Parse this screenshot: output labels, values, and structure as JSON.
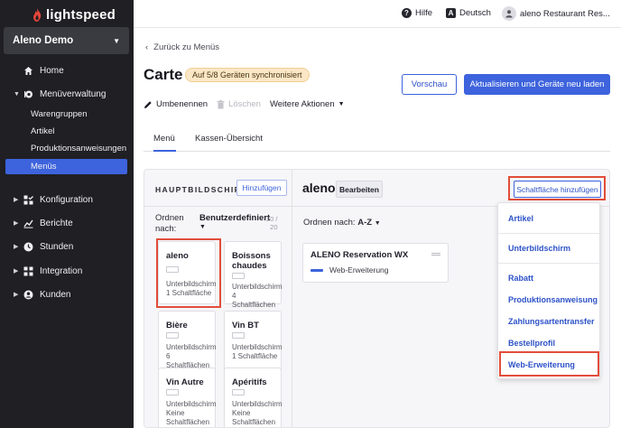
{
  "sidebar": {
    "logo_text": "lightspeed",
    "store_name": "Aleno Demo",
    "nav": [
      {
        "label": "Home",
        "icon": "home-icon"
      },
      {
        "label": "Menüverwaltung",
        "icon": "menu-management-icon"
      },
      {
        "label": "Konfiguration",
        "icon": "configuration-icon"
      },
      {
        "label": "Berichte",
        "icon": "reports-icon"
      },
      {
        "label": "Stunden",
        "icon": "clock-icon"
      },
      {
        "label": "Integration",
        "icon": "integration-icon"
      },
      {
        "label": "Kunden",
        "icon": "customers-icon"
      }
    ],
    "sub": [
      "Warengruppen",
      "Artikel",
      "Produktionsanweisungen",
      "Menüs"
    ]
  },
  "topbar": {
    "help": "Hilfe",
    "language": "Deutsch",
    "account": "aleno Restaurant Res..."
  },
  "page": {
    "back_link": "Zurück zu Menüs",
    "title": "Carte",
    "sync_badge": "Auf 5/8 Geräten synchronisiert",
    "preview_button": "Vorschau",
    "update_button": "Aktualisieren und Geräte neu laden",
    "actions": {
      "rename": "Umbenennen",
      "delete": "Löschen",
      "more": "Weitere Aktionen"
    },
    "tabs": [
      "Menü",
      "Kassen-Übersicht"
    ]
  },
  "left_panel": {
    "title": "HAUPTBILDSCHIRME",
    "add_button": "Hinzufügen",
    "sort_label_1": "Ordnen",
    "sort_label_2": "nach:",
    "sort_value": "Benutzerdefiniert",
    "count_1": "20 /",
    "count_2": "20",
    "cards": [
      {
        "name": "aleno",
        "type": "Unterbildschirm",
        "detail": "1 Schaltfläche"
      },
      {
        "name": "Boissons chaudes",
        "type": "Unterbildschirm",
        "detail": "4 Schaltflächen"
      },
      {
        "name": "Bière",
        "type": "Unterbildschirm",
        "detail": "6 Schaltflächen"
      },
      {
        "name": "Vin BT",
        "type": "Unterbildschirm",
        "detail": "1 Schaltfläche"
      },
      {
        "name": "Vin Autre",
        "type": "Unterbildschirm",
        "detail": "Keine Schaltflächen"
      },
      {
        "name": "Apéritifs",
        "type": "Unterbildschirm",
        "detail": "Keine Schaltflächen"
      }
    ]
  },
  "right_panel": {
    "title": "aleno",
    "edit_button": "Bearbeiten",
    "add_button": "Schaltfläche hinzufügen",
    "sort_label": "Ordnen nach:",
    "sort_value": "A-Z",
    "item": {
      "name": "ALENO Reservation WX",
      "type": "Web-Erweiterung"
    }
  },
  "dropdown": {
    "items": [
      "Artikel",
      "Unterbildschirm",
      "Rabatt",
      "Produktionsanweisung",
      "Zahlungsartentransfer",
      "Bestellprofil",
      "Web-Erweiterung"
    ]
  },
  "colors": {
    "accent": "#3d63dd",
    "highlight": "#e14d3a",
    "sidebar": "#1f1f24",
    "badge": "#fbe7c6"
  }
}
